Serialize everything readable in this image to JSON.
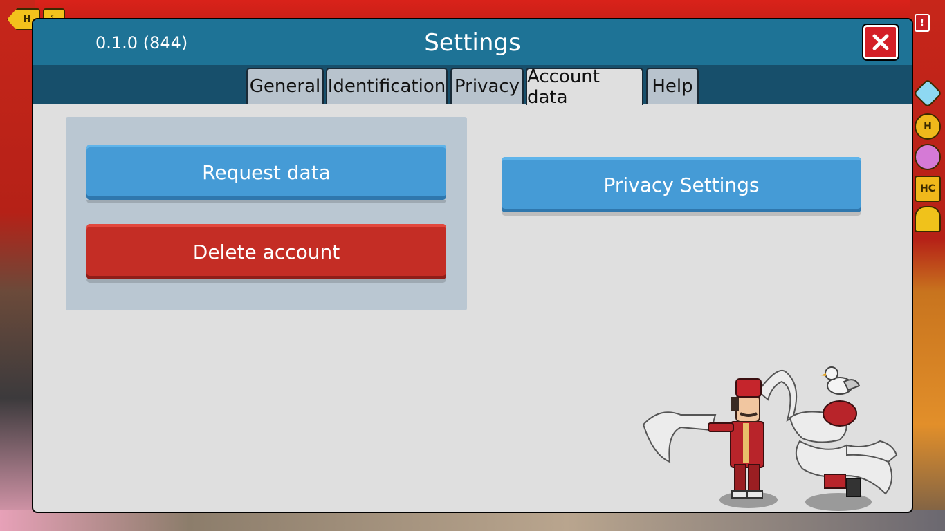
{
  "hud": {
    "back_icon": "home-arrow-icon",
    "shrink_icon": "collapse-arrows-icon",
    "alert_label": "!",
    "currencies": [
      "diamond-icon",
      "credits-icon",
      "duckets-icon",
      "hc-icon",
      "builders-club-icon"
    ]
  },
  "window": {
    "version": "0.1.0 (844)",
    "title": "Settings",
    "close_icon": "close-icon"
  },
  "tabs": [
    {
      "label": "General"
    },
    {
      "label": "Identification"
    },
    {
      "label": "Privacy"
    },
    {
      "label": "Account data",
      "active": true
    },
    {
      "label": "Help"
    }
  ],
  "account_data": {
    "request_label": "Request data",
    "delete_label": "Delete account",
    "privacy_settings_label": "Privacy Settings"
  },
  "colors": {
    "header": "#1e7396",
    "tabbar": "#174f6b",
    "blue_button": "#459bd6",
    "red_button": "#c42d25",
    "close_button": "#d42028"
  }
}
